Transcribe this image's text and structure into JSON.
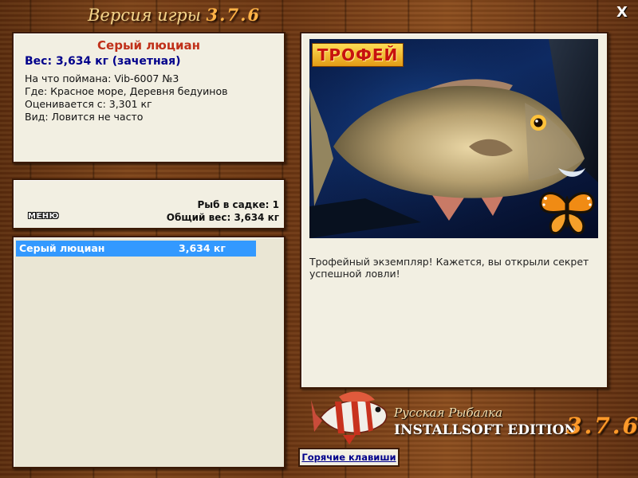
{
  "header": {
    "title_prefix": "Версия игры",
    "version": "3.7.6",
    "close_label": "X"
  },
  "fish_info": {
    "name": "Серый люциан",
    "weight": "Вес: 3,634 кг (зачетная)",
    "bait": "На что поймана: Vib-6007 №3",
    "location": "Где: Красное море, Деревня бедуинов",
    "valued_from": "Оценивается с: 3,301 кг",
    "type": "Вид: Ловится не часто"
  },
  "cage": {
    "menu_label": "МЕНЮ",
    "count": "Рыб в садке: 1",
    "total_weight": "Общий вес: 3,634 кг"
  },
  "catch_list": [
    {
      "name": "Серый люциан",
      "weight": "3,634 кг"
    }
  ],
  "detail": {
    "badge": "ТРОФЕЙ",
    "description": "Трофейный экземпляр! Кажется, вы открыли секрет успешной ловли!"
  },
  "branding": {
    "subtitle": "Русская Рыбалка",
    "edition": "INSTALLSOFT EDITION",
    "version": "3.7.6"
  },
  "footer": {
    "hotkeys_label": "Горячие клавиши"
  },
  "colors": {
    "accent_title": "#c0301a",
    "accent_weight": "#00008b",
    "selection": "#3399ff",
    "panel_bg": "#f2efe2",
    "wood": "#6a3512"
  }
}
